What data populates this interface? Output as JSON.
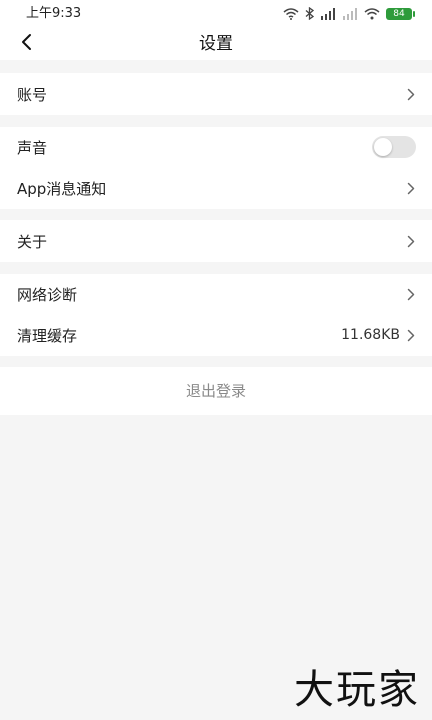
{
  "status_bar": {
    "time": "上午9:33",
    "battery": "84",
    "battery_color": "#2e9b3b"
  },
  "header": {
    "title": "设置",
    "back_icon": "chevron-left-icon"
  },
  "sections": {
    "account": {
      "label": "账号"
    },
    "sound": {
      "label": "声音",
      "toggle_on": false
    },
    "notifications": {
      "label": "App消息通知"
    },
    "about": {
      "label": "关于"
    },
    "network": {
      "label": "网络诊断"
    },
    "cache": {
      "label": "清理缓存",
      "value": "11.68KB"
    }
  },
  "logout": {
    "label": "退出登录"
  },
  "watermark": {
    "text": "大玩家"
  },
  "colors": {
    "background": "#f5f5f5",
    "card": "#ffffff",
    "logout_text": "#8a8a8a",
    "toggle_off": "#e4e4e4"
  }
}
